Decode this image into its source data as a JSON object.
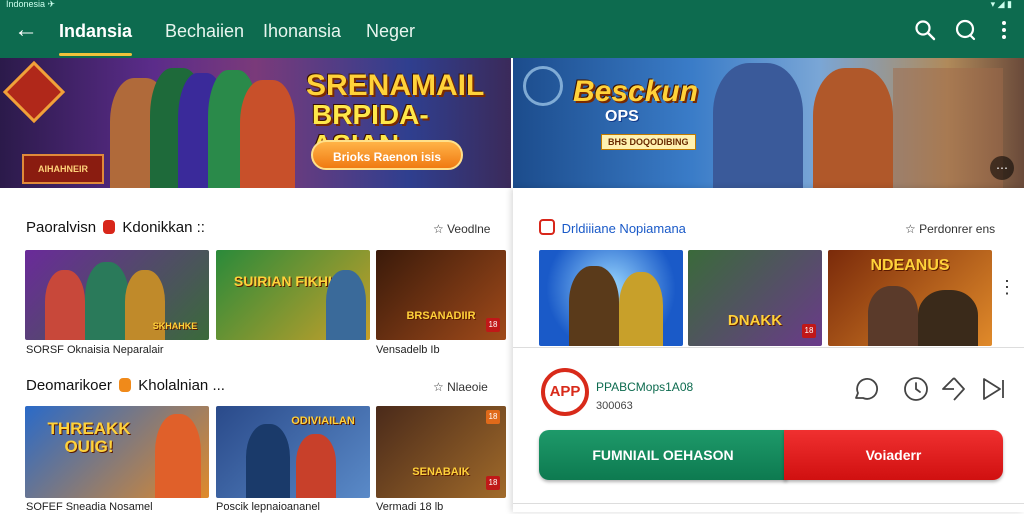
{
  "statusbar": {
    "left": "Indonesia ✈",
    "right": "▾ ◢ ▮"
  },
  "header": {
    "back_icon": "arrow-left-icon",
    "tabs": [
      {
        "label": "Indansia",
        "active": true
      },
      {
        "label": "Bechaiien",
        "active": false
      },
      {
        "label": "Ihonansia",
        "active": false
      },
      {
        "label": "Neger",
        "active": false
      }
    ],
    "icons": [
      "search-icon",
      "chat-icon",
      "more-vert-icon"
    ]
  },
  "banner_left": {
    "title_line1": "SRENAMAIL",
    "title_line2": "BRPIDA-ASIAN",
    "button_label": "Brioks Raenon isis",
    "logo_text": "AIHAHNEIR"
  },
  "banner_right": {
    "title_line1": "Besckun",
    "title_line2": "OPS",
    "tag_text": "BHS DOQODIBING",
    "more_icon": "more-icon"
  },
  "left_sections": [
    {
      "title": "Paoralvisn",
      "badge_color": "#d8261a",
      "title_tail": "Kdonikkan ::",
      "see_all": "Veodlne",
      "items": [
        {
          "title": "SKHAHKE",
          "caption": "SORSF Oknaisia Neparalair"
        },
        {
          "title": "SUIRIAN FIKHIGS",
          "caption": ""
        },
        {
          "title": "BRSANADIIR",
          "caption": "Vensadelb Ib"
        }
      ]
    },
    {
      "title": "Deomarikoer",
      "badge_color": "#f08a1a",
      "title_tail": "Kholalnian ...",
      "see_all": "Nlaeoie",
      "items": [
        {
          "title": "THREAKK OUIG!",
          "caption": "SOFEF Sneadia Nosamel"
        },
        {
          "title": "ODIVIAILAN",
          "caption": "Poscik lepnaioananel"
        },
        {
          "title": "SENABAIK",
          "caption": "Vermadi 18 lb"
        }
      ]
    }
  ],
  "right_section": {
    "title": "Drldiiiane Nopiamana",
    "see_all": "Perdonrer ens",
    "items": [
      {
        "title": ""
      },
      {
        "title": "DNAKK"
      },
      {
        "title": "NDEANUS"
      }
    ]
  },
  "app_card": {
    "logo_text": "APP",
    "name": "PPABCMops1A08",
    "sub": "300063",
    "actions": [
      "comment-icon",
      "clock-icon",
      "share-icon",
      "play-icon"
    ]
  },
  "buttons": {
    "primary": "FUMNIAIL OEHASON",
    "secondary": "Voiaderr"
  }
}
